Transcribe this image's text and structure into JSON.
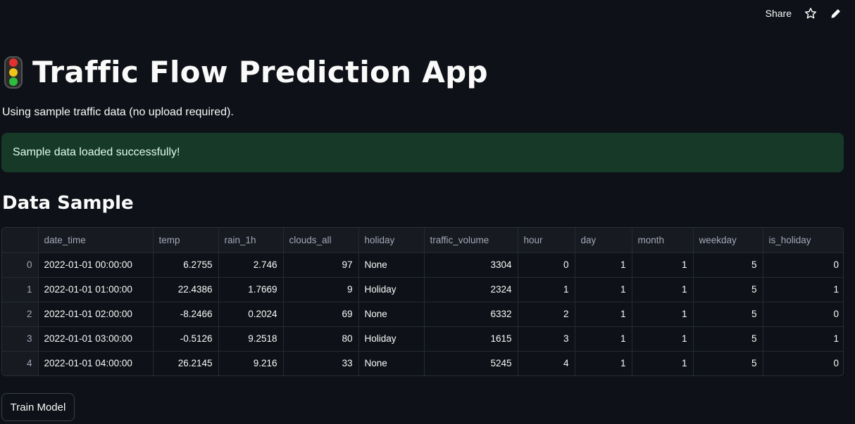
{
  "toolbar": {
    "share_label": "Share",
    "star_icon": "star-icon",
    "edit_icon": "pencil-icon"
  },
  "header": {
    "emoji_icon": "traffic-light-icon",
    "title": "Traffic Flow Prediction App"
  },
  "caption": "Using sample traffic data (no upload required).",
  "success_message": "Sample data loaded successfully!",
  "section_title": "Data Sample",
  "table": {
    "columns": [
      "",
      "date_time",
      "temp",
      "rain_1h",
      "clouds_all",
      "holiday",
      "traffic_volume",
      "hour",
      "day",
      "month",
      "weekday",
      "is_holiday"
    ],
    "rows": [
      [
        "0",
        "2022-01-01 00:00:00",
        "6.2755",
        "2.746",
        "97",
        "None",
        "3304",
        "0",
        "1",
        "1",
        "5",
        "0"
      ],
      [
        "1",
        "2022-01-01 01:00:00",
        "22.4386",
        "1.7669",
        "9",
        "Holiday",
        "2324",
        "1",
        "1",
        "1",
        "5",
        "1"
      ],
      [
        "2",
        "2022-01-01 02:00:00",
        "-8.2466",
        "0.2024",
        "69",
        "None",
        "6332",
        "2",
        "1",
        "1",
        "5",
        "0"
      ],
      [
        "3",
        "2022-01-01 03:00:00",
        "-0.5126",
        "9.2518",
        "80",
        "Holiday",
        "1615",
        "3",
        "1",
        "1",
        "5",
        "1"
      ],
      [
        "4",
        "2022-01-01 04:00:00",
        "26.2145",
        "9.216",
        "33",
        "None",
        "5245",
        "4",
        "1",
        "1",
        "5",
        "0"
      ]
    ]
  },
  "train_button_label": "Train Model",
  "colors": {
    "background": "#0e1117",
    "success_bg": "#173928",
    "success_text": "#dffde9",
    "header_text": "#a3a8b8"
  }
}
